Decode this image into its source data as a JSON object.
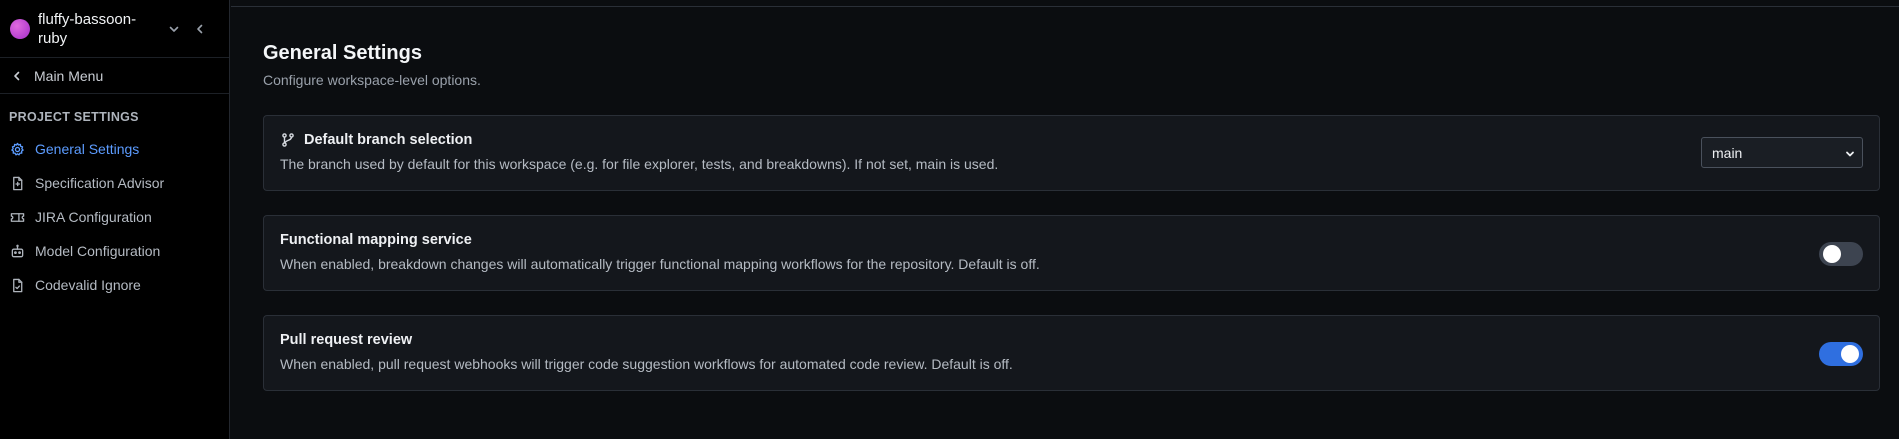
{
  "sidebar": {
    "workspace_name": "fluffy-bassoon-ruby",
    "main_menu_label": "Main Menu",
    "section_title": "PROJECT SETTINGS",
    "items": [
      {
        "label": "General Settings",
        "icon": "gear-icon",
        "active": true
      },
      {
        "label": "Specification Advisor",
        "icon": "document-icon",
        "active": false
      },
      {
        "label": "JIRA Configuration",
        "icon": "ticket-icon",
        "active": false
      },
      {
        "label": "Model Configuration",
        "icon": "robot-icon",
        "active": false
      },
      {
        "label": "Codevalid Ignore",
        "icon": "file-icon",
        "active": false
      }
    ]
  },
  "main": {
    "title": "General Settings",
    "subtitle": "Configure workspace-level options.",
    "cards": [
      {
        "title": "Default branch selection",
        "description": "The branch used by default for this workspace (e.g. for file explorer, tests, and breakdowns). If not set, main is used.",
        "control": "select",
        "selected_value": "main"
      },
      {
        "title": "Functional mapping service",
        "description": "When enabled, breakdown changes will automatically trigger functional mapping workflows for the repository. Default is off.",
        "control": "toggle",
        "enabled": false
      },
      {
        "title": "Pull request review",
        "description": "When enabled, pull request webhooks will trigger code suggestion workflows for automated code review. Default is off.",
        "control": "toggle",
        "enabled": true
      }
    ]
  },
  "colors": {
    "accent": "#5c9cff",
    "toggle_on": "#2f6fe0",
    "background": "#0b0d10",
    "card": "#14171c"
  }
}
